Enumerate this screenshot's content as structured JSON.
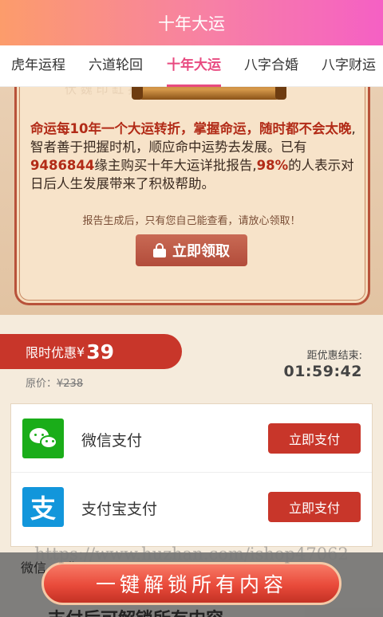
{
  "header": {
    "title": "十年大运"
  },
  "tabs": [
    {
      "label": "虎年运程",
      "active": false
    },
    {
      "label": "六道轮回",
      "active": false
    },
    {
      "label": "十年大运",
      "active": true
    },
    {
      "label": "八字合婚",
      "active": false
    },
    {
      "label": "八字财运",
      "active": false
    }
  ],
  "card": {
    "decor_text": "伏 魏 印 缸 扣 宝",
    "intro_highlight": "命运每10年一个大运转折，掌握命运，随时都不会太晚",
    "intro_part1": ",智者善于把握时机，顺应命中运势去发展。已有",
    "buyer_count": "9486844",
    "intro_part2": "缘主购买十年大运详批报告,",
    "percent": "98%",
    "intro_part3": "的人表示对日后人生发展带来了积极帮助。",
    "note": "报告生成后，只有您自己能查看，请放心领取！",
    "claim_button": "立即领取"
  },
  "promo": {
    "price_label": "限时优惠",
    "currency": "¥",
    "price": "39",
    "original_label": "原价：",
    "original_price": "¥238",
    "countdown_label": "距优惠结束:",
    "countdown": "01:59:42"
  },
  "payment": {
    "options": [
      {
        "name": "微信支付",
        "icon": "wechat-icon",
        "button": "立即支付"
      },
      {
        "name": "支付宝支付",
        "icon": "alipay-icon",
        "button": "立即支付"
      }
    ]
  },
  "watermark": "https://www.huzhan.com/ishop47062",
  "bottom": {
    "unlock_button": "一键解锁所有内容",
    "behind_text_top": "微信 ... 集！",
    "behind_text_bottom": "支付后可解锁所有内容"
  },
  "colors": {
    "header_gradient": [
      "#fc9c6b",
      "#f560c4"
    ],
    "accent_pink": "#e84a80",
    "accent_red": "#c8362a",
    "highlight_red": "#b22b17",
    "wechat_green": "#1aad19",
    "alipay_blue": "#1296db"
  }
}
